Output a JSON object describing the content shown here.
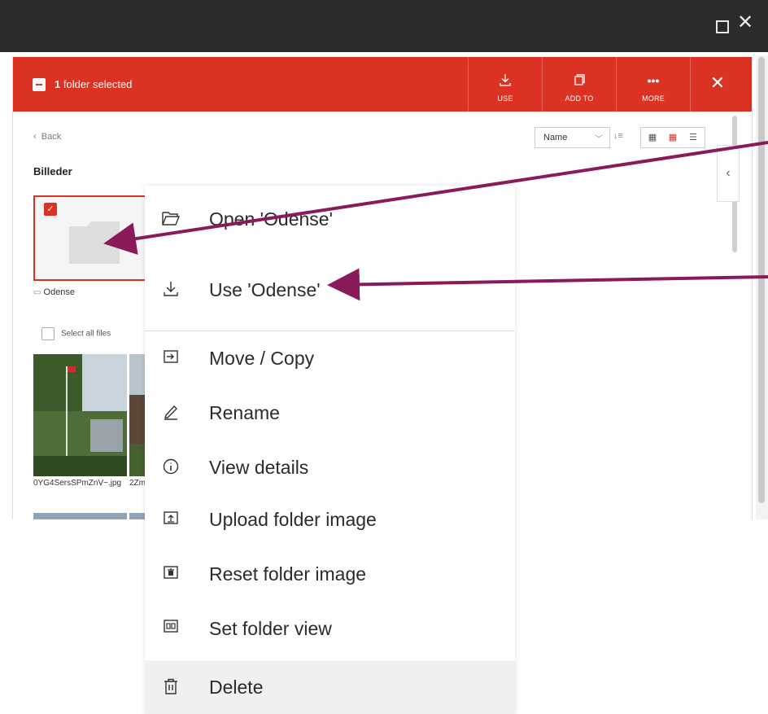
{
  "selection": {
    "count": "1",
    "text": "folder selected"
  },
  "toolbar": {
    "use_label": "USE",
    "add_to_label": "ADD TO",
    "more_label": "MORE"
  },
  "nav": {
    "back": "Back",
    "folder_title": "Billeder"
  },
  "sort": {
    "field": "Name"
  },
  "folder": {
    "name": "Odense"
  },
  "select_all": {
    "label": "Select all files"
  },
  "files": [
    {
      "name": "0YG4SersSPmZnV~.jpg"
    },
    {
      "name": "2Zm"
    }
  ],
  "context_menu": {
    "items": [
      {
        "label": "Open 'Odense'",
        "icon": "folder-open-icon"
      },
      {
        "label": "Use 'Odense'",
        "icon": "download-icon"
      },
      {
        "label": "Move / Copy",
        "icon": "move-icon"
      },
      {
        "label": "Rename",
        "icon": "pencil-icon"
      },
      {
        "label": "View details",
        "icon": "info-icon"
      },
      {
        "label": "Upload folder image",
        "icon": "upload-image-icon"
      },
      {
        "label": "Reset folder image",
        "icon": "reset-image-icon"
      },
      {
        "label": "Set folder view",
        "icon": "folder-view-icon"
      },
      {
        "label": "Delete",
        "icon": "trash-icon"
      }
    ]
  },
  "colors": {
    "brand": "#dc3223",
    "annotation_arrow": "#8b1a5a",
    "titlebar": "#2b2b2b"
  }
}
